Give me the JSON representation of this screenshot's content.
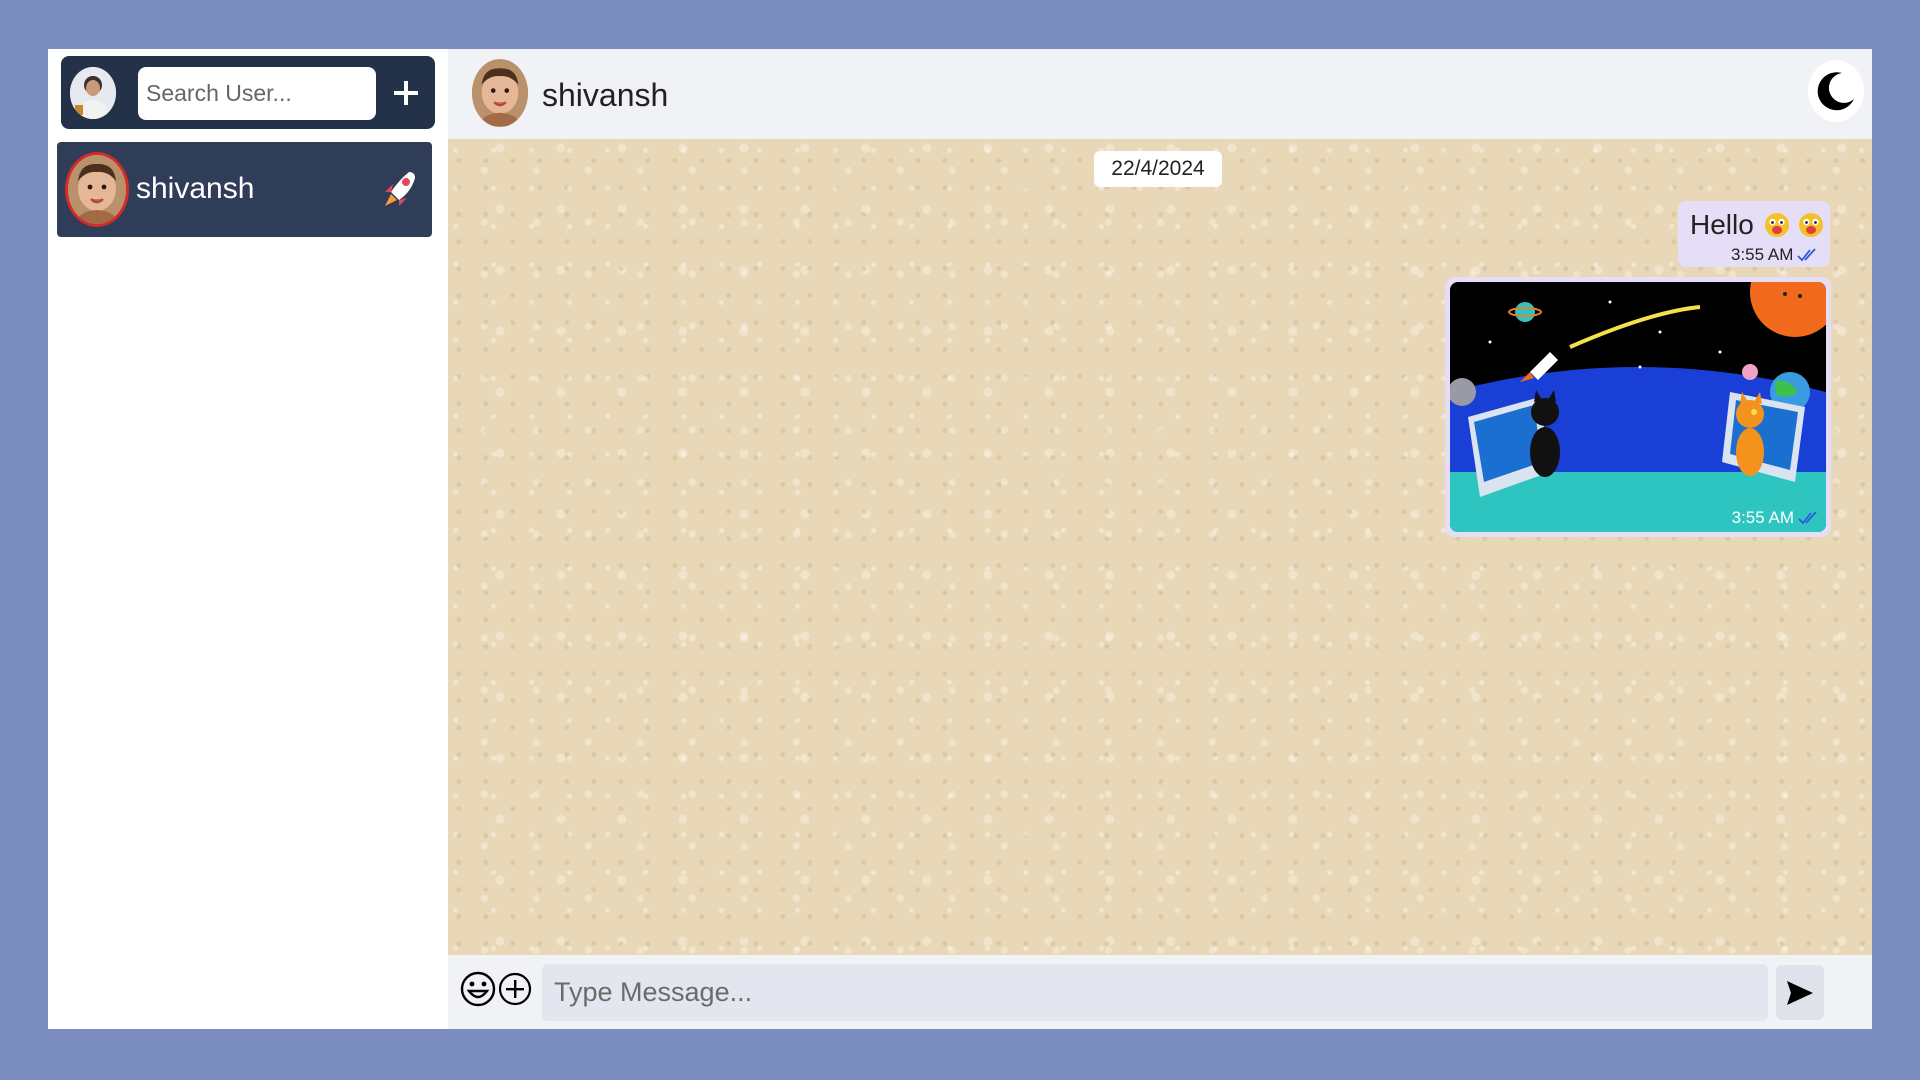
{
  "sidebar": {
    "search": {
      "placeholder": "Search User..."
    },
    "add_icon": "plus-icon",
    "chats": [
      {
        "name": "shivansh",
        "status_icon": "rocket-icon",
        "selected": true
      }
    ]
  },
  "chat": {
    "header": {
      "name": "shivansh",
      "theme_icon": "moon-icon"
    },
    "date_separator": "22/4/2024",
    "messages": [
      {
        "type": "text",
        "text": "Hello",
        "emojis": [
          "grinning-emoji",
          "grinning-emoji"
        ],
        "time": "3:55 AM",
        "status_icon": "double-check-icon"
      },
      {
        "type": "image",
        "image": "space-cats-image",
        "time": "3:55 AM",
        "status_icon": "double-check-icon"
      }
    ],
    "composer": {
      "placeholder": "Type Message...",
      "emoji_icon": "smiley-icon",
      "attach_icon": "plus-circle-icon",
      "send_icon": "send-icon"
    }
  },
  "colors": {
    "page_bg": "#7b8dbf",
    "sidebar_header": "#243249",
    "selected_chat": "#2f3d58",
    "bubble": "#e6ddf6",
    "chat_bg": "#e9d8b8",
    "tick_blue": "#2b5bd7"
  }
}
